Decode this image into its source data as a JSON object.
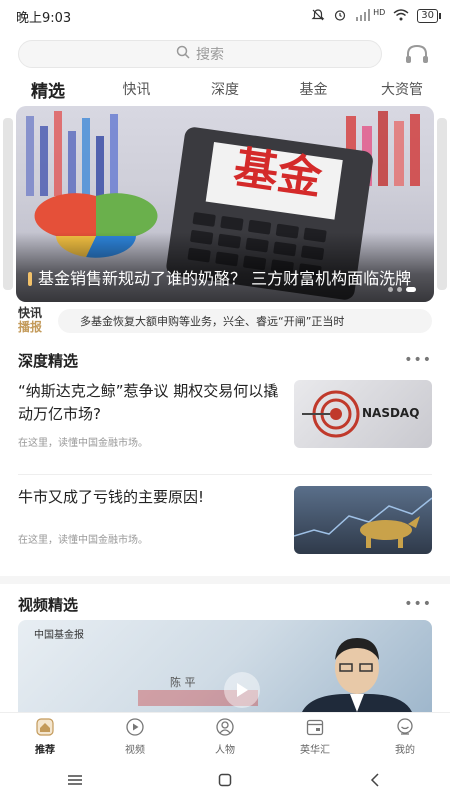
{
  "status_bar": {
    "time": "晚上9:03",
    "network": "HD",
    "battery": "30"
  },
  "search": {
    "placeholder": "搜索"
  },
  "tabs": [
    {
      "label": "精选",
      "active": true
    },
    {
      "label": "快讯",
      "active": false
    },
    {
      "label": "深度",
      "active": false
    },
    {
      "label": "基金",
      "active": false
    },
    {
      "label": "大资管",
      "active": false
    }
  ],
  "banner": {
    "image_text": "基金",
    "title": "基金销售新规动了谁的奶酪？ 三方财富机构面临洗牌"
  },
  "flash": {
    "logo_line1": "快讯",
    "logo_line2": "播报",
    "text": "多基金恢复大额申购等业务，兴全、睿远“开闸”正当时"
  },
  "sections": {
    "deep": "深度精选",
    "video": "视频精选"
  },
  "articles": [
    {
      "title": "“纳斯达克之鲸”惹争议 期权交易何以撬动万亿市场?",
      "desc": "在这里，读懂中国金融市场。",
      "thumb_label": "NASDAQ"
    },
    {
      "title": "牛市又成了亏钱的主要原因!",
      "desc": "在这里，读懂中国金融市场。",
      "thumb_label": ""
    }
  ],
  "video": {
    "brand": "中国基金报",
    "person_name": "陈  平"
  },
  "bottom_nav": [
    {
      "label": "推荐",
      "icon": "home-icon",
      "active": true
    },
    {
      "label": "视频",
      "icon": "video-icon",
      "active": false
    },
    {
      "label": "人物",
      "icon": "person-icon",
      "active": false
    },
    {
      "label": "英华汇",
      "icon": "calendar-icon",
      "active": false
    },
    {
      "label": "我的",
      "icon": "profile-icon",
      "active": false
    }
  ],
  "colors": {
    "accent_gold": "#c39a5a",
    "banner_red": "#d42a2a"
  }
}
